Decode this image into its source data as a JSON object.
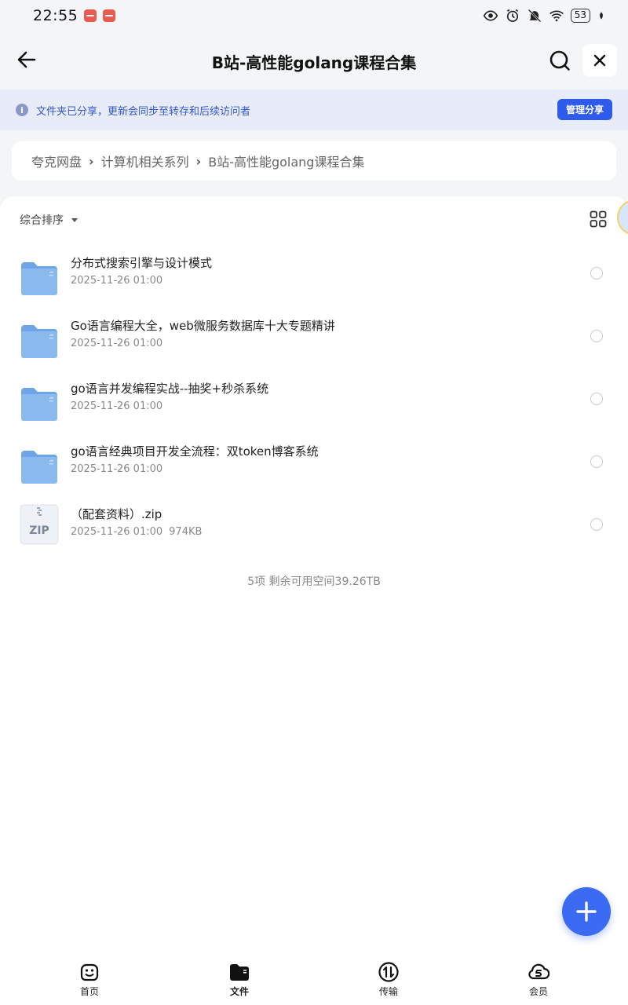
{
  "status_bar": {
    "time": "22:55",
    "battery": "53"
  },
  "header": {
    "title": "B站-高性能golang课程合集"
  },
  "share_banner": {
    "text": "文件夹已分享，更新会同步至转存和后续访问者",
    "manage_label": "管理分享"
  },
  "breadcrumb": [
    "夸克网盘",
    "计算机相关系列",
    "B站-高性能golang课程合集"
  ],
  "sort": {
    "label": "综合排序"
  },
  "files": [
    {
      "name": "分布式搜索引擎与设计模式",
      "date": "2025-11-26 01:00",
      "size": "",
      "type": "folder"
    },
    {
      "name": "Go语言编程大全，web微服务数据库十大专题精讲",
      "date": "2025-11-26 01:00",
      "size": "",
      "type": "folder"
    },
    {
      "name": "go语言并发编程实战--抽奖+秒杀系统",
      "date": "2025-11-26 01:00",
      "size": "",
      "type": "folder"
    },
    {
      "name": "go语言经典项目开发全流程：双token博客系统",
      "date": "2025-11-26 01:00",
      "size": "",
      "type": "folder"
    },
    {
      "name": "（配套资料）.zip",
      "date": "2025-11-26 01:00",
      "size": "974KB",
      "type": "zip",
      "icon_text": "ZIP"
    }
  ],
  "summary": "5项 剩余可用空间39.26TB",
  "bottom_nav": [
    {
      "label": "首页",
      "icon": "home-face-icon"
    },
    {
      "label": "文件",
      "icon": "folder-icon"
    },
    {
      "label": "传输",
      "icon": "transfer-icon"
    },
    {
      "label": "会员",
      "icon": "vip-cloud-icon"
    }
  ],
  "colors": {
    "accent": "#2f5bea",
    "banner_bg": "#e8ecf8",
    "folder": "#8ab9ee"
  }
}
